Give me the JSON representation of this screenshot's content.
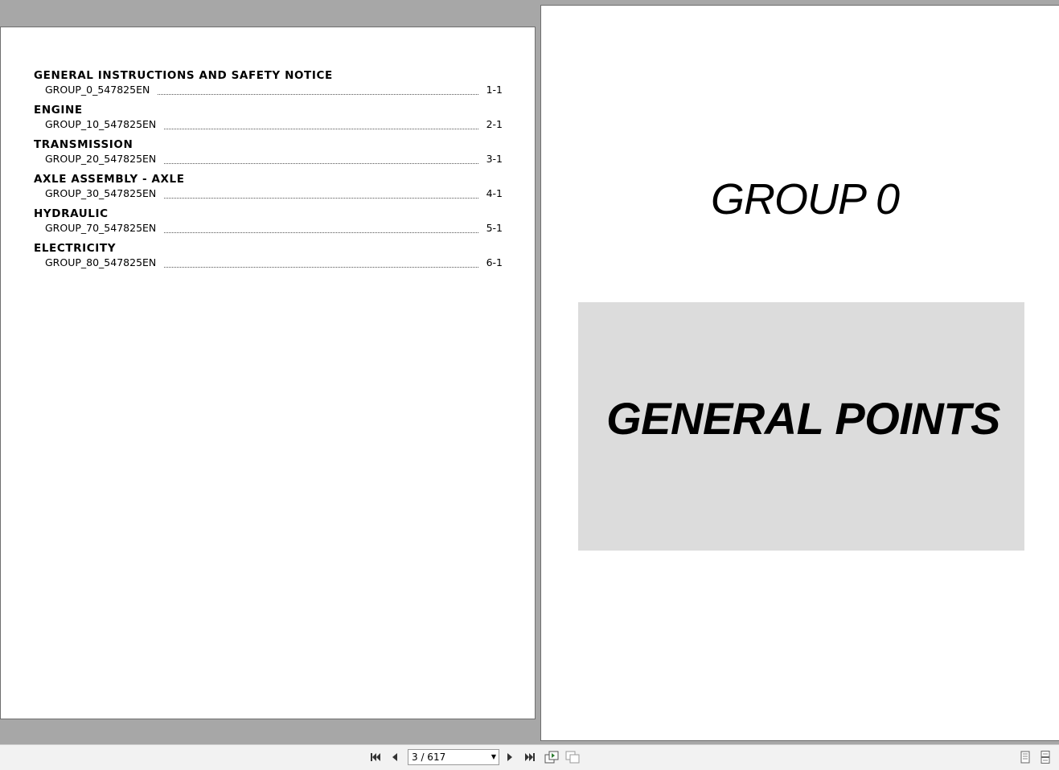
{
  "toc": {
    "entries": [
      {
        "heading": "GENERAL INSTRUCTIONS AND SAFETY NOTICE",
        "item": "GROUP_0_547825EN",
        "page": "1-1"
      },
      {
        "heading": "ENGINE",
        "item": "GROUP_10_547825EN",
        "page": "2-1"
      },
      {
        "heading": "TRANSMISSION",
        "item": "GROUP_20_547825EN",
        "page": "3-1"
      },
      {
        "heading": "AXLE ASSEMBLY - AXLE",
        "item": "GROUP_30_547825EN",
        "page": "4-1"
      },
      {
        "heading": "HYDRAULIC",
        "item": "GROUP_70_547825EN",
        "page": "5-1"
      },
      {
        "heading": "ELECTRICITY",
        "item": "GROUP_80_547825EN",
        "page": "6-1"
      }
    ]
  },
  "right_page": {
    "group_title": "GROUP 0",
    "box_title": "GENERAL POINTS",
    "box_color": "#dcdcdc"
  },
  "toolbar": {
    "page_indicator": "3 / 617",
    "icons": [
      "first-page-icon",
      "previous-page-icon",
      "next-page-icon",
      "last-page-icon",
      "previous-view-icon",
      "next-view-icon",
      "single-page-view-icon",
      "continuous-view-icon"
    ]
  },
  "colors": {
    "viewer_background": "#a7a7a7",
    "toolbar_background": "#f2f2f2"
  }
}
